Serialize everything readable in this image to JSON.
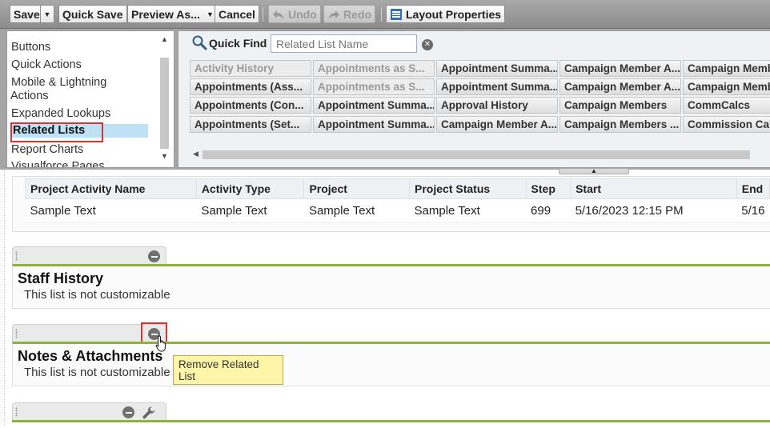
{
  "toolbar": {
    "save": "Save",
    "quick_save": "Quick Save",
    "preview_as": "Preview As...",
    "cancel": "Cancel",
    "undo": "Undo",
    "redo": "Redo",
    "layout_properties": "Layout Properties"
  },
  "palette": {
    "categories": [
      {
        "label": "Buttons"
      },
      {
        "label": "Quick Actions"
      },
      {
        "label": "Mobile & Lightning"
      },
      {
        "label": "Actions"
      },
      {
        "label": "Expanded Lookups"
      },
      {
        "label": "Related Lists"
      },
      {
        "label": "Report Charts"
      },
      {
        "label": "Visualforce Pages"
      }
    ],
    "selected_category": "Related Lists",
    "quick_find_label": "Quick Find",
    "quick_find_placeholder": "Related List Name",
    "items": [
      [
        "Activity History",
        "Appointments as S...",
        "Appointment Summa...",
        "Campaign Member A...",
        "Campaign Memb"
      ],
      [
        "Appointments (Ass...",
        "Appointments as S...",
        "Appointment Summa...",
        "Campaign Member A...",
        "Campaign Memb"
      ],
      [
        "Appointments (Con...",
        "Appointment Summa...",
        "Approval History",
        "Campaign Members",
        "CommCalcs"
      ],
      [
        "Appointments (Set...",
        "Appointment Summa...",
        "Campaign Member A...",
        "Campaign Members ...",
        "Commission Calc"
      ]
    ]
  },
  "activity_table": {
    "headers": [
      "Project Activity Name",
      "Activity Type",
      "Project",
      "Project Status",
      "Step",
      "Start",
      "End"
    ],
    "row": [
      "Sample Text",
      "Sample Text",
      "Sample Text",
      "Sample Text",
      "699",
      "5/16/2023 12:15 PM",
      "5/16"
    ]
  },
  "sections": [
    {
      "title": "Staff History",
      "note": "This list is not customizable"
    },
    {
      "title": "Notes & Attachments",
      "note": "This list is not customizable"
    }
  ],
  "tooltip": "Remove Related List",
  "colors": {
    "accent_green": "#8db33c",
    "highlight_red": "#e03030",
    "selected_blue": "#bfe1f6",
    "tooltip_yellow": "#fff5a8"
  }
}
